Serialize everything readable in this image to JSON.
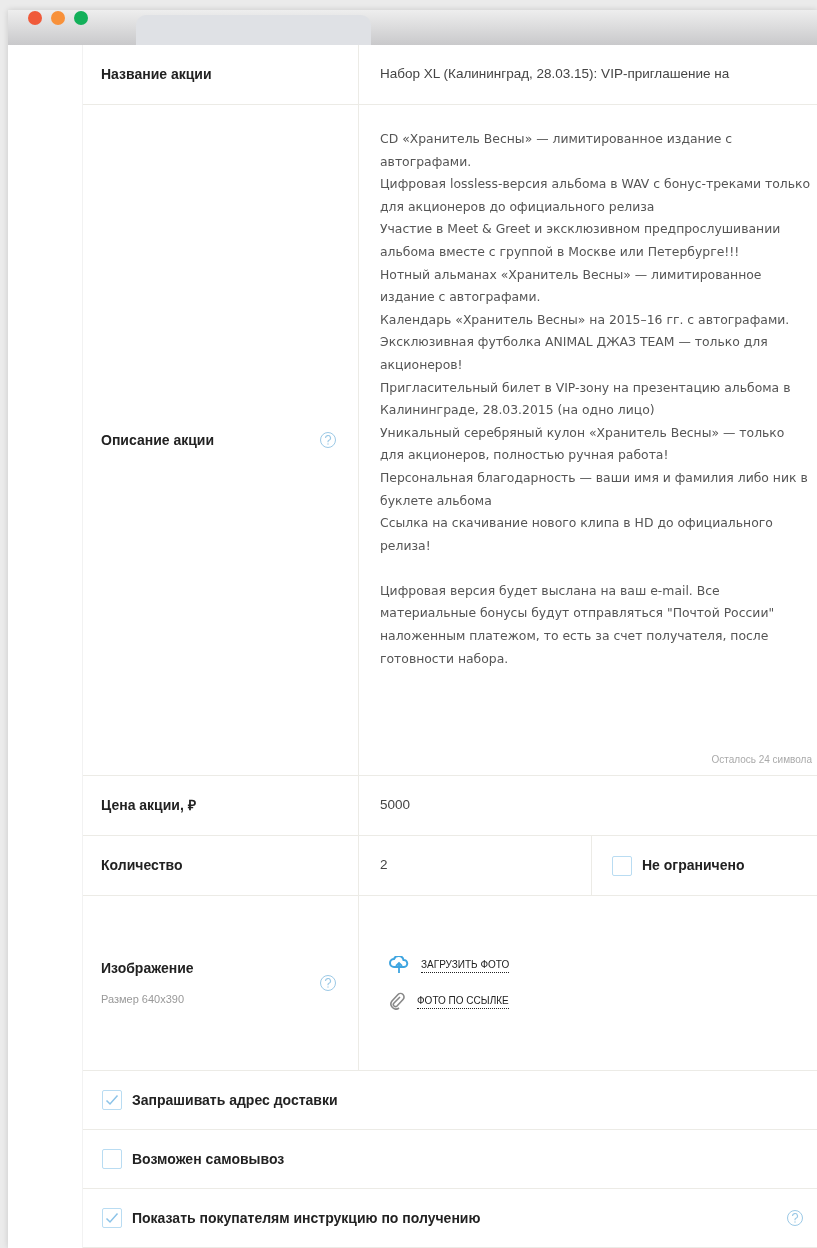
{
  "form": {
    "rows": [
      {
        "kind": "text",
        "label": "Название акции",
        "value": "Набор XL (Калининград, 28.03.15): VIP-приглашение на"
      },
      {
        "kind": "textarea",
        "label": "Описание акции",
        "help": true,
        "paragraphs": [
          "CD «Хранитель Весны» — лимитированное издание с автографами.",
          "Цифровая lossless-версия альбома в WAV с бонус-треками только для акционеров до официального релиза",
          "Участие в Meet & Greet и эксклюзивном предпрослушивании альбома вместе с группой в Москве или Петербурге!!!",
          "Нотный альманах «Хранитель Весны» — лимитированное издание с автографами.",
          "Календарь «Хранитель Весны» на 2015–16 гг. с автографами.",
          "Эксклюзивная футболка ANIMAL ДЖАЗ TEAM — только для акционеров!",
          "Пригласительный билет в VIP-зону на презентацию альбома в Калининграде, 28.03.2015 (на одно лицо)",
          "Уникальный серебряный кулон «Хранитель Весны» — только для акционеров, полностью ручная работа!",
          "Персональная благодарность — ваши имя и фамилия либо ник в буклете альбома",
          "Ссылка на скачивание нового клипа в HD до официального релиза!"
        ],
        "note": "Цифровая версия будет выслана на ваш e-mail. Все материальные бонусы будут отправляться \"Почтой России\" наложенным платежом, то есть за счет получателя, после готовности набора.",
        "counter": "Осталось 24 символа"
      },
      {
        "kind": "text",
        "label": "Цена акции, ₽",
        "value": "5000"
      },
      {
        "kind": "quantity",
        "label": "Количество",
        "value": "2",
        "option": {
          "label": "Не ограничено",
          "checked": false
        }
      },
      {
        "kind": "image",
        "label": "Изображение",
        "hint": "Размер 640x390",
        "help": true,
        "links": [
          {
            "kind": "upload",
            "label": "ЗАГРУЗИТЬ ФОТО"
          },
          {
            "kind": "link",
            "label": "ФОТО ПО ССЫЛКЕ"
          }
        ]
      }
    ],
    "options": [
      {
        "label": "Запрашивать адрес доставки",
        "checked": true,
        "help": false
      },
      {
        "label": "Возможен самовывоз",
        "checked": false,
        "help": false
      },
      {
        "label": "Показать покупателям инструкцию по получению",
        "checked": true,
        "help": true
      }
    ]
  }
}
